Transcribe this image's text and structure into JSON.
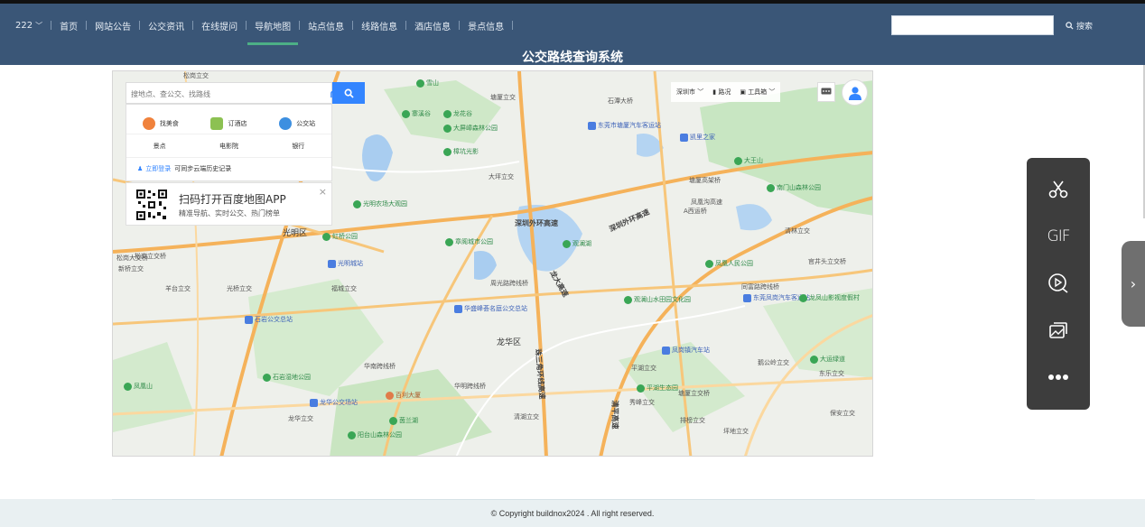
{
  "header": {
    "user_menu": "222",
    "nav": [
      {
        "label": "首页"
      },
      {
        "label": "网站公告"
      },
      {
        "label": "公交资讯"
      },
      {
        "label": "在线提问"
      },
      {
        "label": "导航地图",
        "active": true
      },
      {
        "label": "站点信息"
      },
      {
        "label": "线路信息"
      },
      {
        "label": "酒店信息"
      },
      {
        "label": "景点信息"
      }
    ],
    "search_value": "",
    "search_button": "搜索",
    "site_title": "公交路线查询系统",
    "colors": {
      "bar": "#3a5677",
      "active_underline": "#4caf86"
    }
  },
  "map": {
    "search_placeholder": "搜地点、查公交、找路线",
    "route_tooltip": "路线",
    "quick_links": [
      {
        "label": "找美食",
        "icon": "food-icon",
        "color": "#f0823c"
      },
      {
        "label": "订酒店",
        "icon": "hotel-icon",
        "color": "#8cc152"
      },
      {
        "label": "公交站",
        "icon": "bus-stop-icon",
        "color": "#3d8fe0"
      }
    ],
    "categories": [
      "景点",
      "电影院",
      "银行"
    ],
    "login_link": "立即登录",
    "login_hint": "可同步云端历史记录",
    "qr_title": "扫码打开百度地图APP",
    "qr_subtitle": "精准导航、实时公交、热门榜单",
    "city": "深圳市",
    "traffic": "路况",
    "toolbox": "工具箱",
    "districts": [
      "光明区",
      "龙华区"
    ],
    "highways": [
      "深圳外环高速",
      "深圳外环高速",
      "龙大高速",
      "珠三角环线高速",
      "清平高速"
    ],
    "pois": [
      {
        "name": "雪山",
        "type": "park"
      },
      {
        "name": "寨溪谷",
        "type": "park"
      },
      {
        "name": "龙花谷",
        "type": "park"
      },
      {
        "name": "大屏嶂森林公园",
        "type": "park"
      },
      {
        "name": "樟坑光影",
        "type": "park"
      },
      {
        "name": "东莞市塘厦汽车客运站",
        "type": "bus"
      },
      {
        "name": "凯里之家",
        "type": "bus"
      },
      {
        "name": "大王山",
        "type": "park"
      },
      {
        "name": "南门山森林公园",
        "type": "park"
      },
      {
        "name": "光明农场大观园",
        "type": "park"
      },
      {
        "name": "虹桥公园",
        "type": "park"
      },
      {
        "name": "光明城站",
        "type": "bus"
      },
      {
        "name": "观澜湖",
        "type": "park"
      },
      {
        "name": "章阁城市公园",
        "type": "park"
      },
      {
        "name": "凤凰人民公园",
        "type": "park"
      },
      {
        "name": "东莞凤岗汽车客运站",
        "type": "bus"
      },
      {
        "name": "龙凤山影视度假村",
        "type": "park"
      },
      {
        "name": "观澜山水田园文化园",
        "type": "park"
      },
      {
        "name": "华盛峰荟名庭公交总站",
        "type": "bus"
      },
      {
        "name": "石岩公交总站",
        "type": "bus"
      },
      {
        "name": "凤岗镇汽车站",
        "type": "bus"
      },
      {
        "name": "石岩湿地公园",
        "type": "park"
      },
      {
        "name": "凤凰山",
        "type": "park"
      },
      {
        "name": "平湖生态园",
        "type": "park"
      },
      {
        "name": "大运绿道",
        "type": "park"
      },
      {
        "name": "龙华公交场站",
        "type": "bus"
      },
      {
        "name": "茵兰湖",
        "type": "park"
      },
      {
        "name": "阳台山森林公园",
        "type": "park"
      },
      {
        "name": "百利大厦",
        "type": "poi"
      }
    ],
    "roads": [
      "松岗立交",
      "塘厦立交",
      "石潭大桥",
      "塘厦高架桥",
      "凤凰沟高速",
      "A西运桥",
      "大坪立交",
      "清林立交",
      "松岗大交桥",
      "松岗立交桥",
      "新桥立交",
      "羊台立交",
      "光桥立交",
      "官井头立交桥",
      "同富路跨线桥",
      "周光路跨线桥",
      "福城立交",
      "凤岗立交",
      "华南城桥",
      "华南跨线桥",
      "龙华桥",
      "黄阁立交",
      "华明跨线桥",
      "平湖立交",
      "清湖立交",
      "秀峰立交",
      "排榜立交",
      "坪地立交",
      "东乐立交",
      "保安立交",
      "龙岗立交",
      "凤岗立交桥",
      "茜坑立交",
      "鹅公岭立交",
      "塘厦立交桥",
      "吉华立交",
      "水官立交",
      "布吉立交",
      "石龙仔立交",
      "吉华路跨线桥",
      "丰岗立交",
      "龙华立交"
    ]
  },
  "sidebar_tools": [
    {
      "name": "scissors-icon"
    },
    {
      "name": "gif-icon",
      "label": "GIF"
    },
    {
      "name": "video-record-icon"
    },
    {
      "name": "gallery-icon"
    },
    {
      "name": "more-icon"
    }
  ],
  "footer": {
    "copyright": "© Copyright buildnox2024 . All right reserved."
  }
}
